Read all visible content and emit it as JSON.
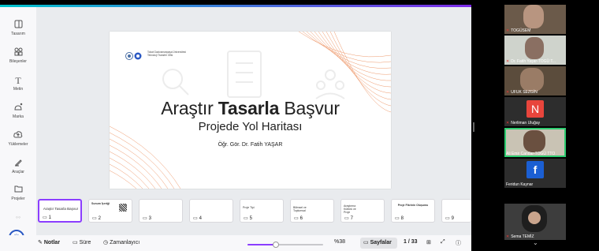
{
  "sidebar": {
    "items": [
      {
        "label": "Tasarım",
        "icon": "layout-icon"
      },
      {
        "label": "Bileşenler",
        "icon": "elements-icon"
      },
      {
        "label": "Metin",
        "icon": "text-icon"
      },
      {
        "label": "Marka",
        "icon": "brand-icon"
      },
      {
        "label": "Yüklemeler",
        "icon": "upload-icon"
      },
      {
        "label": "Araçlar",
        "icon": "draw-icon"
      },
      {
        "label": "Projeler",
        "icon": "folder-icon"
      },
      {
        "label": "",
        "icon": "apps-icon"
      }
    ],
    "magic_icon": "sparkle-icon"
  },
  "slide": {
    "logo_text": "Tokat Gaziosmanpaşa Üniversitesi Teknoloji Transfer Ofisi",
    "title_part1": "Araştır ",
    "title_part2": "Tasarla",
    "title_part3": " Başvur",
    "subtitle": "Projede Yol Haritası",
    "author": "Öğr. Gör. Dr. Fatih YAŞAR"
  },
  "thumbnails": [
    {
      "num": "1",
      "mini": "Araştır Tasarla Başvur"
    },
    {
      "num": "2",
      "mini": "Sunum İçeriği"
    },
    {
      "num": "3",
      "mini": ""
    },
    {
      "num": "4",
      "mini": ""
    },
    {
      "num": "5",
      "mini": "Proje Tipi"
    },
    {
      "num": "6",
      "mini": "Bilimsel ve Toplumsal"
    },
    {
      "num": "7",
      "mini": "Araştırma Kültürü ve Proje"
    },
    {
      "num": "8",
      "mini": "Proje Fikrinin Oluşumu"
    },
    {
      "num": "9",
      "mini": ""
    }
  ],
  "bottombar": {
    "notes": "Notlar",
    "duration": "Süre",
    "timer": "Zamanlayıcı",
    "zoom": "%38",
    "zoom_level": 0.38,
    "pages": "Sayfalar",
    "page_count": "1 / 33"
  },
  "participants": [
    {
      "name": "TOGÜSEM"
    },
    {
      "name": "Dr. Fatih Yaşar-TOGÜ T..."
    },
    {
      "name": "UFUK SEZGİN"
    },
    {
      "name": "Nerliman Uluğay",
      "initial": "N"
    },
    {
      "name": "Ali Emir Candar-TOGÜ TTO"
    },
    {
      "name": "Feridun Kaynar",
      "initial": "f"
    },
    {
      "name": "Sema TEMİZ"
    }
  ],
  "colors": {
    "accent_purple": "#8b3dff",
    "speaking_green": "#2ecc71",
    "slide_orange": "#e8763a"
  }
}
